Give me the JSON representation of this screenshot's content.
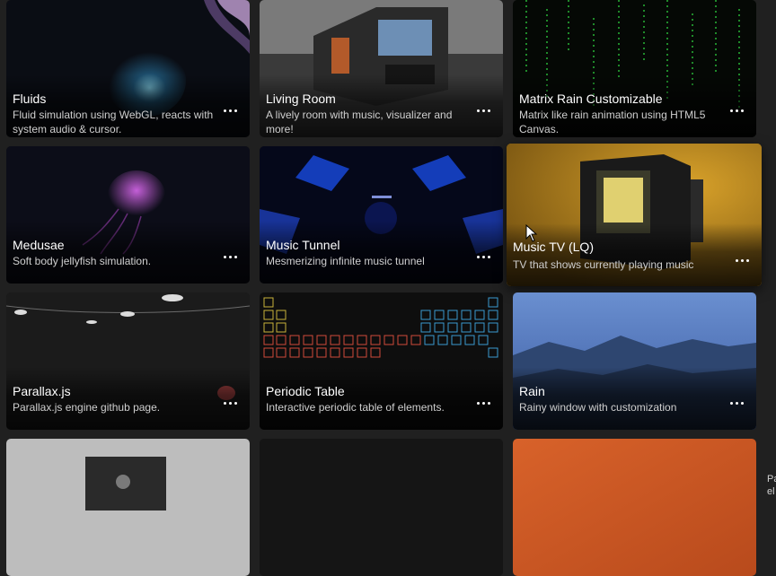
{
  "cards": [
    {
      "title": "Fluids",
      "description": "Fluid simulation using WebGL, reacts with system audio & cursor.",
      "thumb_colors": [
        "#0b1a2a",
        "#1b3d5e",
        "#c9a6d8"
      ]
    },
    {
      "title": "Living Room",
      "description": "A lively room with music, visualizer and more!",
      "thumb_colors": [
        "#cfcfcf",
        "#2a2a2a",
        "#b35a2a"
      ]
    },
    {
      "title": "Matrix Rain Customizable",
      "description": "Matrix like rain animation using HTML5 Canvas.",
      "thumb_colors": [
        "#050a05",
        "#1f8a2a"
      ]
    },
    {
      "title": "Medusae",
      "description": "Soft body jellyfish simulation.",
      "thumb_colors": [
        "#0a0c18",
        "#a23fbf"
      ]
    },
    {
      "title": "Music Tunnel",
      "description": "Mesmerizing infinite music tunnel",
      "thumb_colors": [
        "#05081c",
        "#1846d6"
      ]
    },
    {
      "title": "Music TV (LQ)",
      "description": "TV that shows currently playing music",
      "thumb_colors": [
        "#b9861a",
        "#1a1a1a",
        "#e0d070"
      ]
    },
    {
      "title": "Parallax.js",
      "description": "Parallax.js engine github page.",
      "thumb_colors": [
        "#1b1b1b",
        "#d85050"
      ]
    },
    {
      "title": "Periodic Table",
      "description": "Interactive periodic table of elements.",
      "thumb_colors": [
        "#0e0e0e",
        "#c8b23a",
        "#3a9ad0",
        "#d04a3a"
      ]
    },
    {
      "title": "Rain",
      "description": "Rainy window with customization",
      "thumb_colors": [
        "#5a82c6",
        "#23344f"
      ]
    },
    {
      "title": "",
      "description": "",
      "thumb_colors": [
        "#bdbdbd",
        "#2a2a2a"
      ]
    },
    {
      "title": "",
      "description": "",
      "thumb_colors": [
        "#151515"
      ]
    },
    {
      "title": "",
      "description": "",
      "thumb_colors": [
        "#d8622a",
        "#b84a1c"
      ]
    }
  ],
  "edge_text": "Pa el",
  "more_icon": "more-horizontal-icon",
  "cursor_icon": "mouse-pointer-icon"
}
